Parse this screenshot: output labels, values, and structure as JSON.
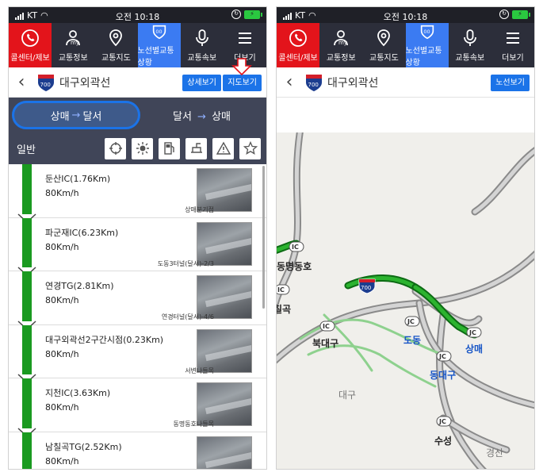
{
  "status": {
    "carrier": "KT",
    "time": "오전 10:18"
  },
  "nav": {
    "items": [
      {
        "label": "콜센터/제보",
        "icon": "phone-icon"
      },
      {
        "label": "교통정보",
        "icon": "my-person-icon"
      },
      {
        "label": "교통지도",
        "icon": "map-pin-icon"
      },
      {
        "label": "노선별교통상황",
        "icon": "highway-shield-icon"
      },
      {
        "label": "교통속보",
        "icon": "microphone-icon"
      },
      {
        "label": "더보기",
        "icon": "menu-icon"
      }
    ]
  },
  "route": {
    "number": "700",
    "name": "대구외곽선"
  },
  "buttons": {
    "detail": "상세보기",
    "map": "지도보기",
    "route": "노선보기"
  },
  "direction": {
    "active": {
      "from": "상매",
      "to": "달서"
    },
    "inactive": {
      "from": "달서",
      "to": "상매"
    }
  },
  "filter": {
    "label": "일반"
  },
  "cctv": [
    {
      "name": "둔산IC(1.76Km)",
      "speed": "80Km/h",
      "cam": "상매분기점"
    },
    {
      "name": "파군재IC(6.23Km)",
      "speed": "80Km/h",
      "cam": "도동3터널(달서)-2/3"
    },
    {
      "name": "연경TG(2.81Km)",
      "speed": "80Km/h",
      "cam": "연경터널(달서)-4/6"
    },
    {
      "name": "대구외곽선2구간시점(0.23Km)",
      "speed": "80Km/h",
      "cam": "서변나들목"
    },
    {
      "name": "지천IC(3.63Km)",
      "speed": "80Km/h",
      "cam": "동명동호나들목"
    },
    {
      "name": "남칠곡TG(2.52Km)",
      "speed": "80Km/h",
      "cam": ""
    }
  ],
  "map": {
    "shield": "700",
    "labels": [
      "동명동호",
      "칠곡",
      "북대구",
      "도동",
      "상매",
      "동대구",
      "대구",
      "수성",
      "경산"
    ],
    "badges": [
      "IC",
      "JC"
    ]
  },
  "colors": {
    "accent": "#1b73e8",
    "nav_bg": "#2c2e3a",
    "red": "#e3141b",
    "route_green": "#1a9a20"
  }
}
